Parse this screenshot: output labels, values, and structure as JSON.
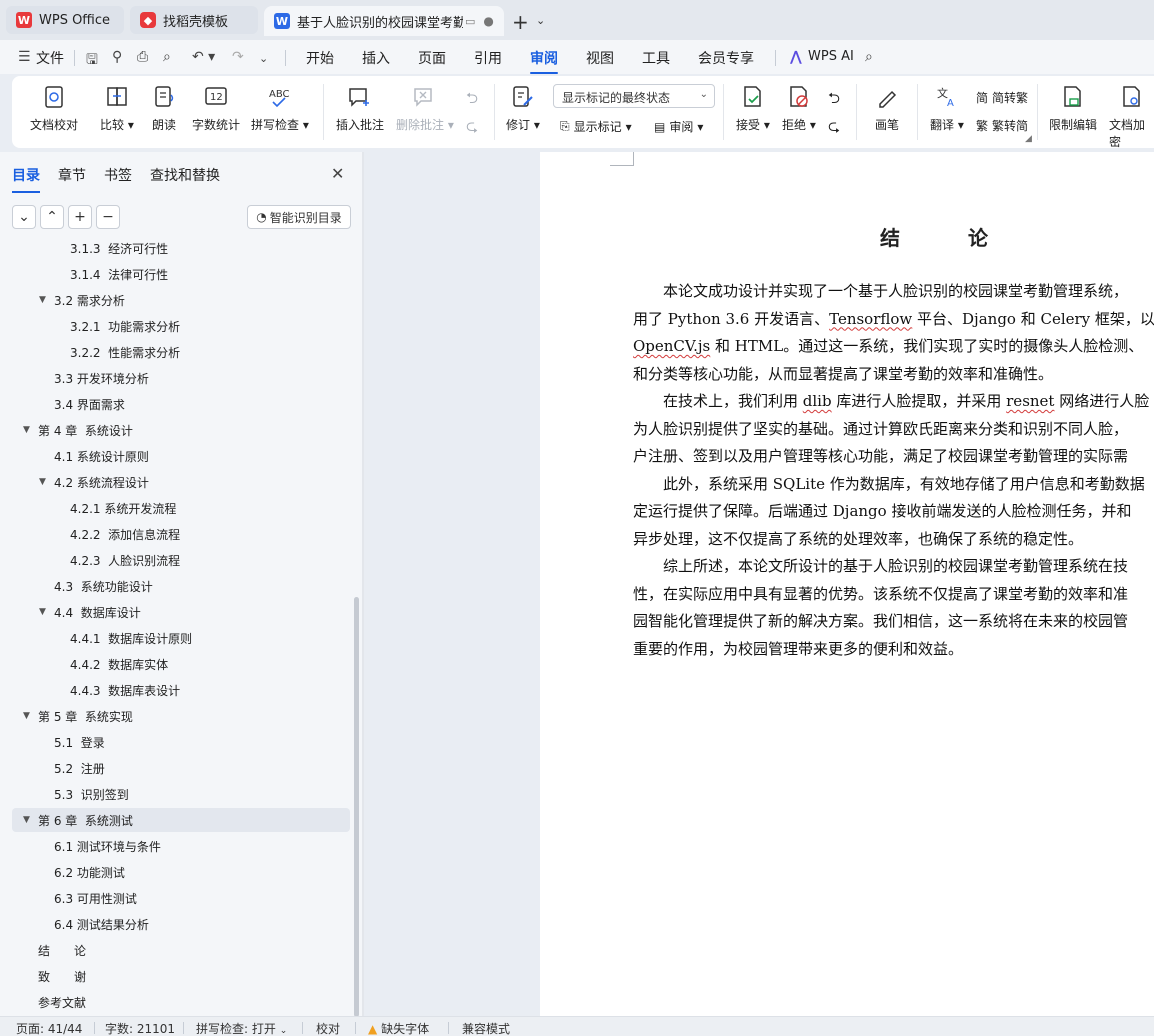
{
  "tabs": [
    {
      "label": "WPS Office",
      "icon": "wps-logo-icon"
    },
    {
      "label": "找稻壳模板",
      "icon": "docer-icon"
    },
    {
      "label": "基于人脸识别的校园课堂考勤",
      "icon": "writer-doc-icon",
      "active": true
    }
  ],
  "menu": {
    "file": "文件",
    "items": [
      "开始",
      "插入",
      "页面",
      "引用",
      "审阅",
      "视图",
      "工具",
      "会员专享"
    ],
    "active": "审阅",
    "wps_ai": "WPS AI"
  },
  "ribbon": {
    "doc_check": "文档校对",
    "compare": "比较",
    "read_aloud": "朗读",
    "word_count": "字数统计",
    "spell_check": "拼写检查",
    "insert_comment": "插入批注",
    "delete_comment": "删除批注",
    "track_changes": "修订",
    "markup_state": "显示标记的最终状态",
    "show_markup": "显示标记",
    "review": "审阅",
    "accept": "接受",
    "reject": "拒绝",
    "ink": "画笔",
    "translate": "翻译",
    "to_traditional": "简转繁",
    "to_simplified": "繁转简",
    "restrict_editing": "限制编辑",
    "doc_encrypt": "文档加密"
  },
  "nav": {
    "tabs": [
      "目录",
      "章节",
      "书签",
      "查找和替换"
    ],
    "active_tab": "目录",
    "smart_toc": "智能识别目录",
    "toc": [
      {
        "label": "3.1.3  经济可行性",
        "level": 3
      },
      {
        "label": "3.1.4  法律可行性",
        "level": 3
      },
      {
        "label": "3.2 需求分析",
        "level": 2,
        "expanded": true
      },
      {
        "label": "3.2.1  功能需求分析",
        "level": 3
      },
      {
        "label": "3.2.2  性能需求分析",
        "level": 3
      },
      {
        "label": "3.3 开发环境分析",
        "level": 2
      },
      {
        "label": "3.4 界面需求",
        "level": 2
      },
      {
        "label": "第 4 章  系统设计",
        "level": 1,
        "expanded": true
      },
      {
        "label": "4.1 系统设计原则",
        "level": 2
      },
      {
        "label": "4.2 系统流程设计",
        "level": 2,
        "expanded": true
      },
      {
        "label": "4.2.1 系统开发流程",
        "level": 3
      },
      {
        "label": "4.2.2  添加信息流程",
        "level": 3
      },
      {
        "label": "4.2.3  人脸识别流程",
        "level": 3
      },
      {
        "label": "4.3  系统功能设计",
        "level": 2
      },
      {
        "label": "4.4  数据库设计",
        "level": 2,
        "expanded": true
      },
      {
        "label": "4.4.1  数据库设计原则",
        "level": 3
      },
      {
        "label": "4.4.2  数据库实体",
        "level": 3
      },
      {
        "label": "4.4.3  数据库表设计",
        "level": 3
      },
      {
        "label": "第 5 章  系统实现",
        "level": 1,
        "expanded": true
      },
      {
        "label": "5.1  登录",
        "level": 2
      },
      {
        "label": "5.2  注册",
        "level": 2
      },
      {
        "label": "5.3  识别签到",
        "level": 2
      },
      {
        "label": "第 6 章  系统测试",
        "level": 1,
        "expanded": true,
        "selected": true
      },
      {
        "label": "6.1 测试环境与条件",
        "level": 2
      },
      {
        "label": "6.2 功能测试",
        "level": 2
      },
      {
        "label": "6.3 可用性测试",
        "level": 2
      },
      {
        "label": "6.4 测试结果分析",
        "level": 2
      },
      {
        "label": "结　　论",
        "level": 1
      },
      {
        "label": "致　　谢",
        "level": 1
      },
      {
        "label": "参考文献",
        "level": 1
      }
    ]
  },
  "document": {
    "title": "结　论",
    "lines": [
      [
        {
          "t": "　　本论文成功设计并实现了一个基于人脸识别的校园课堂考勤管理系统，"
        }
      ],
      [
        {
          "t": "用了 Python 3.6 开发语言、"
        },
        {
          "t": "Tensorflow",
          "sq": true
        },
        {
          "t": " 平台、Django 和 Celery 框架，以"
        }
      ],
      [
        {
          "t": "OpenCV.js",
          "sq": true
        },
        {
          "t": " 和 HTML。通过这一系统，我们实现了实时的摄像头人脸检测、"
        }
      ],
      [
        {
          "t": "和分类等核心功能，从而显著提高了课堂考勤的效率和准确性。"
        }
      ],
      [
        {
          "t": "　　在技术上，我们利用 "
        },
        {
          "t": "dlib",
          "sq": true
        },
        {
          "t": " 库进行人脸提取，并采用 "
        },
        {
          "t": "resnet",
          "sq": true
        },
        {
          "t": " 网络进行人脸"
        }
      ],
      [
        {
          "t": "为人脸识别提供了坚实的基础。通过计算欧氏距离来分类和识别不同人脸，"
        }
      ],
      [
        {
          "t": "户注册、签到以及用户管理等核心功能，满足了校园课堂考勤管理的实际需"
        }
      ],
      [
        {
          "t": "　　此外，系统采用 SQLite 作为数据库，有效地存储了用户信息和考勤数据"
        }
      ],
      [
        {
          "t": "定运行提供了保障。后端通过 Django 接收前端发送的人脸检测任务，并和"
        }
      ],
      [
        {
          "t": "异步处理，这不仅提高了系统的处理效率，也确保了系统的稳定性。"
        }
      ],
      [
        {
          "t": "　　综上所述，本论文所设计的基于人脸识别的校园课堂考勤管理系统在技"
        }
      ],
      [
        {
          "t": "性，在实际应用中具有显著的优势。该系统不仅提高了课堂考勤的效率和准"
        }
      ],
      [
        {
          "t": "园智能化管理提供了新的解决方案。我们相信，这一系统将在未来的校园管"
        }
      ],
      [
        {
          "t": "重要的作用，为校园管理带来更多的便利和效益。"
        }
      ]
    ]
  },
  "status": {
    "page": "页面: 41/44",
    "word_count": "字数: 21101",
    "spell_check": "拼写检查: 打开",
    "proofread": "校对",
    "missing_fonts": "缺失字体",
    "compat_mode": "兼容模式"
  },
  "colors": {
    "accent": "#1a5fe0",
    "wps_red": "#e8393c",
    "warning": "#f0a020"
  }
}
